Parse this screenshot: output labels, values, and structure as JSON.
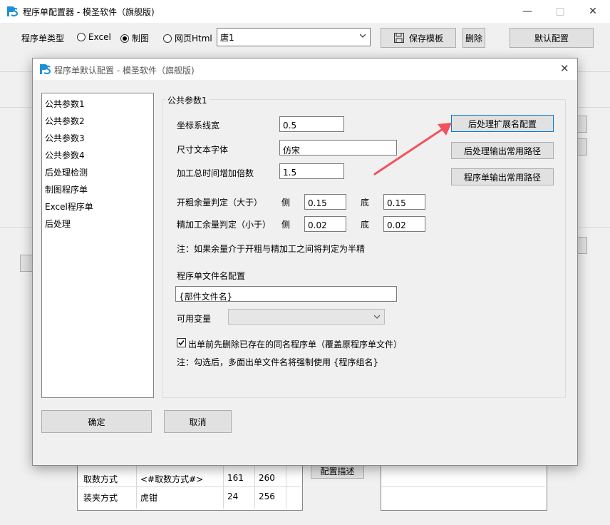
{
  "app": {
    "title": "程序单配置器 - 模圣软件（旗舰版)",
    "logo_icon": "ps-logo-icon"
  },
  "toolbar": {
    "type_label": "程序单类型",
    "radio_excel": "Excel",
    "radio_drawing": "制图",
    "radio_web": "网页Html",
    "selected_type": "制图",
    "template_value": "唐1",
    "save_template": "保存模板",
    "delete": "删除",
    "default_config": "默认配置"
  },
  "background": {
    "row1_label": "取数方式",
    "row1_value": "<#取数方式#>",
    "row1_a": "161",
    "row1_b": "260",
    "row2_label": "装夹方式",
    "row2_value": "虎钳",
    "row2_a": "24",
    "row2_b": "256",
    "config_desc": "配置描述"
  },
  "dialog": {
    "title": "程序单默认配置 - 模圣软件（旗舰版)",
    "nav": [
      "公共参数1",
      "公共参数2",
      "公共参数3",
      "公共参数4",
      "后处理检测",
      "制图程序单",
      "Excel程序单",
      "后处理"
    ],
    "selected_nav": "公共参数1",
    "group_title": "公共参数1",
    "fields": {
      "coord_width_label": "坐标系线宽",
      "coord_width_value": "0.5",
      "dim_font_label": "尺寸文本字体",
      "dim_font_value": "仿宋",
      "time_mult_label": "加工总时间增加倍数",
      "time_mult_value": "1.5",
      "rough_label": "开粗余量判定（大于）",
      "rough_side_label": "侧",
      "rough_side_value": "0.15",
      "rough_bottom_label": "底",
      "rough_bottom_value": "0.15",
      "finish_label": "精加工余量判定（小于）",
      "finish_side_label": "侧",
      "finish_side_value": "0.02",
      "finish_bottom_label": "底",
      "finish_bottom_value": "0.02",
      "note1": "注：如果余量介于开粗与精加工之间将判定为半精",
      "filename_label": "程序单文件名配置",
      "filename_value": "{部件文件名}",
      "vars_label": "可用变量",
      "vars_value": "",
      "checkbox_label": "出单前先删除已存在的同名程序单（覆盖原程序单文件）",
      "checkbox_checked": true,
      "note2": "注：勾选后，多面出单文件名将强制使用 {程序组名}"
    },
    "side_buttons": {
      "ext_config": "后处理扩展名配置",
      "post_path": "后处理输出常用路径",
      "sheet_path": "程序单输出常用路径"
    },
    "ok": "确定",
    "cancel": "取消"
  },
  "colors": {
    "arrow": "#f2525e",
    "focus_border": "#0078d7",
    "logo_blue": "#1e90d6"
  }
}
